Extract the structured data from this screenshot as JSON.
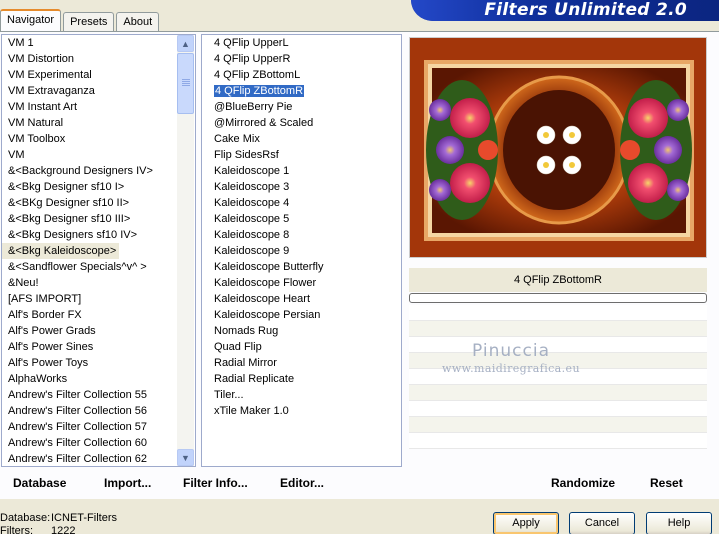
{
  "tabs": [
    "Navigator",
    "Presets",
    "About"
  ],
  "app_title": "Filters Unlimited 2.0",
  "categories": [
    "VM 1",
    "VM Distortion",
    "VM Experimental",
    "VM Extravaganza",
    "VM Instant Art",
    "VM Natural",
    "VM Toolbox",
    "VM",
    "&<Background Designers IV>",
    "&<Bkg Designer sf10 I>",
    "&<BKg Designer sf10 II>",
    "&<Bkg Designer sf10 III>",
    "&<Bkg Designers sf10 IV>",
    "&<Bkg Kaleidoscope>",
    "&<Sandflower Specials^v^ >",
    "&Neu!",
    "[AFS IMPORT]",
    "Alf's Border FX",
    "Alf's Power Grads",
    "Alf's Power Sines",
    "Alf's Power Toys",
    "AlphaWorks",
    "Andrew's Filter Collection 55",
    "Andrew's Filter Collection 56",
    "Andrew's Filter Collection 57",
    "Andrew's Filter Collection 60",
    "Andrew's Filter Collection 62"
  ],
  "selected_category": "&<Bkg Kaleidoscope>",
  "filters": [
    "4 QFlip UpperL",
    "4 QFlip UpperR",
    "4 QFlip ZBottomL",
    "4 QFlip ZBottomR",
    "@BlueBerry Pie",
    "@Mirrored & Scaled",
    "Cake Mix",
    "Flip SidesRsf",
    "Kaleidoscope 1",
    "Kaleidoscope 3",
    "Kaleidoscope 4",
    "Kaleidoscope 5",
    "Kaleidoscope 8",
    "Kaleidoscope 9",
    "Kaleidoscope Butterfly",
    "Kaleidoscope Flower",
    "Kaleidoscope Heart",
    "Kaleidoscope Persian",
    "Nomads Rug",
    "Quad Flip",
    "Radial Mirror",
    "Radial Replicate",
    "Tiler...",
    "xTile Maker 1.0"
  ],
  "selected_filter": "4 QFlip ZBottomR",
  "preview_filter_name": "4 QFlip ZBottomR",
  "watermark": {
    "name": "Pinuccia",
    "url": "www.maidiregrafica.eu"
  },
  "toolbar": {
    "database": "Database",
    "import": "Import...",
    "filter_info": "Filter Info...",
    "editor": "Editor...",
    "randomize": "Randomize",
    "reset": "Reset"
  },
  "status": {
    "database_label": "Database:",
    "database_value": "ICNET-Filters",
    "filters_label": "Filters:",
    "filters_value": "1222"
  },
  "buttons": {
    "apply": "Apply",
    "cancel": "Cancel",
    "help": "Help"
  },
  "colors": {
    "selection": "#316ac5",
    "header_band": "#0f2f9b",
    "tab_accent": "#e68b2c"
  },
  "icons": {
    "scroll_up": "chevron-up-icon",
    "scroll_down": "chevron-down-icon"
  }
}
